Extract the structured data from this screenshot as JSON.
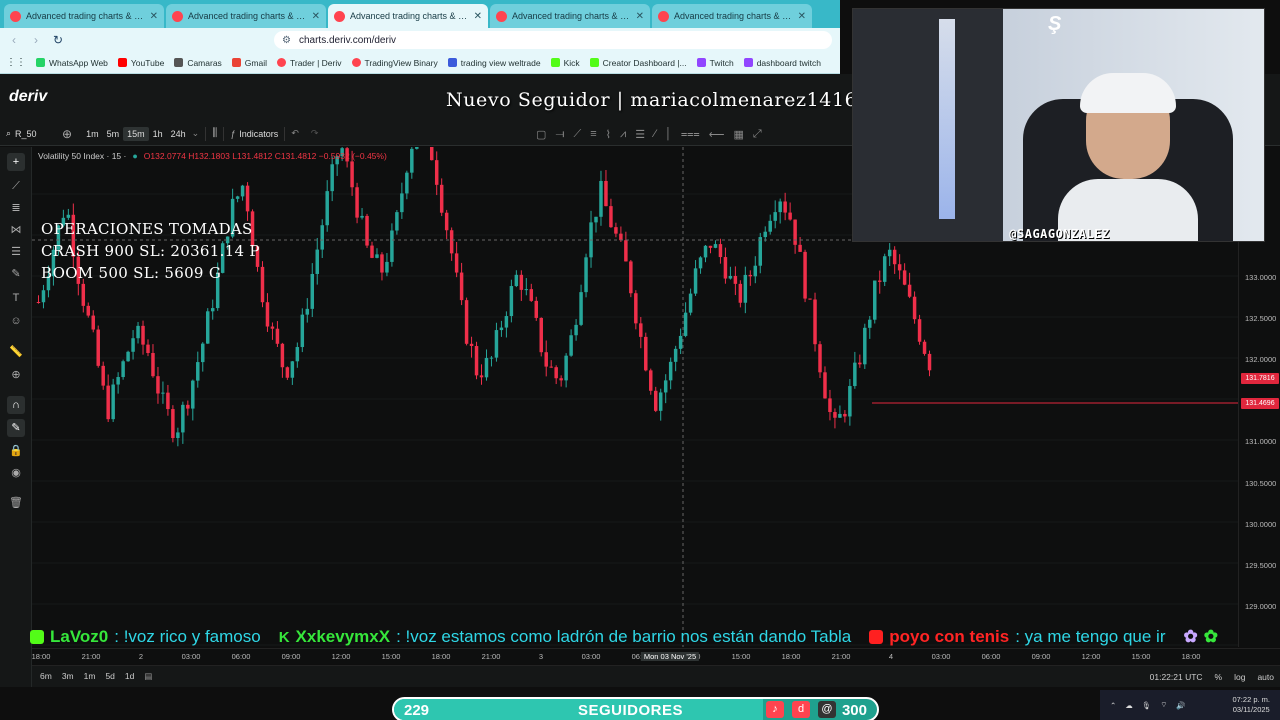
{
  "browser": {
    "tabs": [
      {
        "title": "Advanced trading charts & tools | T",
        "active": false
      },
      {
        "title": "Advanced trading charts & tools | T",
        "active": false
      },
      {
        "title": "Advanced trading charts & tools",
        "active": true
      },
      {
        "title": "Advanced trading charts & tools | T",
        "active": false
      },
      {
        "title": "Advanced trading charts & tools | T",
        "active": false
      }
    ],
    "url": "charts.deriv.com/deriv",
    "bookmarks": [
      {
        "label": "WhatsApp Web",
        "color": "#25d366"
      },
      {
        "label": "YouTube",
        "color": "#ff0000"
      },
      {
        "label": "Camaras",
        "color": "#555555"
      },
      {
        "label": "Gmail",
        "color": "#ea4335"
      },
      {
        "label": "Trader | Deriv",
        "color": "#ff444f"
      },
      {
        "label": "TradingView Binary",
        "color": "#ff444f"
      },
      {
        "label": "trading view weltrade",
        "color": "#3b5bdb"
      },
      {
        "label": "Kick",
        "color": "#53fc18"
      },
      {
        "label": "Creator Dashboard |...",
        "color": "#53fc18"
      },
      {
        "label": "Twitch",
        "color": "#9146ff"
      },
      {
        "label": "dashboard twitch",
        "color": "#9146ff"
      }
    ]
  },
  "app": {
    "logo": "deriv",
    "banner": "Nuevo Seguidor | mariacolmenarez1416"
  },
  "toolbar": {
    "symbol": "R_50",
    "timeframes": [
      "1m",
      "5m",
      "15m",
      "1h",
      "24h"
    ],
    "selected_timeframe": "15m",
    "indicators_label": "Indicators"
  },
  "chart": {
    "instrument": "Volatility 50 Index · 15 ·",
    "open": "O132.0774",
    "high": "H132.1803",
    "low": "L131.4812",
    "close": "C131.4812",
    "change": "−0.5932 (−0.45%)",
    "operations": [
      "OPERACIONES TOMADAS",
      "CRASH 900 SL: 20361.14 P",
      "BOOM 500 SL: 5609 G"
    ],
    "price_ticks": [
      "133.5000",
      "133.0000",
      "132.5000",
      "132.0000",
      "131.5000",
      "131.0000",
      "130.5000",
      "130.0000",
      "129.5000",
      "129.0000"
    ],
    "price_tags": [
      "131.7816",
      "131.4696"
    ],
    "time_ticks": [
      "18:00",
      "21:00",
      "2",
      "03:00",
      "06:00",
      "09:00",
      "12:00",
      "15:00",
      "18:00",
      "21:00",
      "3",
      "03:00",
      "06:00",
      "10:00",
      "15:00",
      "18:00",
      "21:00",
      "4",
      "03:00",
      "06:00",
      "09:00",
      "12:00",
      "15:00",
      "18:00"
    ],
    "cursor_date": "Mon 03 Nov '25",
    "ranges": [
      "6m",
      "3m",
      "1m",
      "5d",
      "1d"
    ],
    "utc_time": "01:22:21 UTC",
    "scale_opts": [
      "%",
      "log",
      "auto"
    ]
  },
  "chart_data": {
    "type": "candlestick",
    "title": "Volatility 50 Index · 15 ·",
    "ylim": [
      128.85,
      133.85
    ],
    "values": [
      132.3,
      132.8,
      133.3,
      132.5,
      131.9,
      131.2,
      131.6,
      132.0,
      131.8,
      131.3,
      131.0,
      131.4,
      131.9,
      132.5,
      133.2,
      133.5,
      132.6,
      132.0,
      131.6,
      131.9,
      132.6,
      133.3,
      133.9,
      133.4,
      132.8,
      132.6,
      133.0,
      133.8,
      134.2,
      133.6,
      132.9,
      132.1,
      131.6,
      131.7,
      132.2,
      132.6,
      132.2,
      131.7,
      131.5,
      132.0,
      132.9,
      133.4,
      133.0,
      132.6,
      131.9,
      131.3,
      131.6,
      132.1,
      132.6,
      132.9,
      132.7,
      132.3,
      132.6,
      133.1,
      133.4,
      133.1,
      132.4,
      131.7,
      131.0,
      131.3,
      131.8,
      132.4,
      132.8,
      132.5,
      132.1,
      131.7
    ]
  },
  "overlay": {
    "ticker": [
      {
        "user": "LaVoz0",
        "msg": ": !voz rico y famoso",
        "color": "#36e63b"
      },
      {
        "user": "XxkevymxX",
        "msg": ": !voz estamos como ladrón de barrio nos están dando Tabla",
        "color": "#36e63b"
      },
      {
        "user": "poyo con tenis",
        "msg": ": ya me tengo que ir",
        "color": "#ff2424"
      }
    ],
    "cam_tag": "@SAGAGONZALEZ",
    "followers": {
      "current": "229",
      "label": "SEGUIDORES",
      "goal": "300",
      "progress": 0.763
    }
  },
  "system": {
    "time": "07:22 p. m.",
    "date": "03/11/2025"
  }
}
